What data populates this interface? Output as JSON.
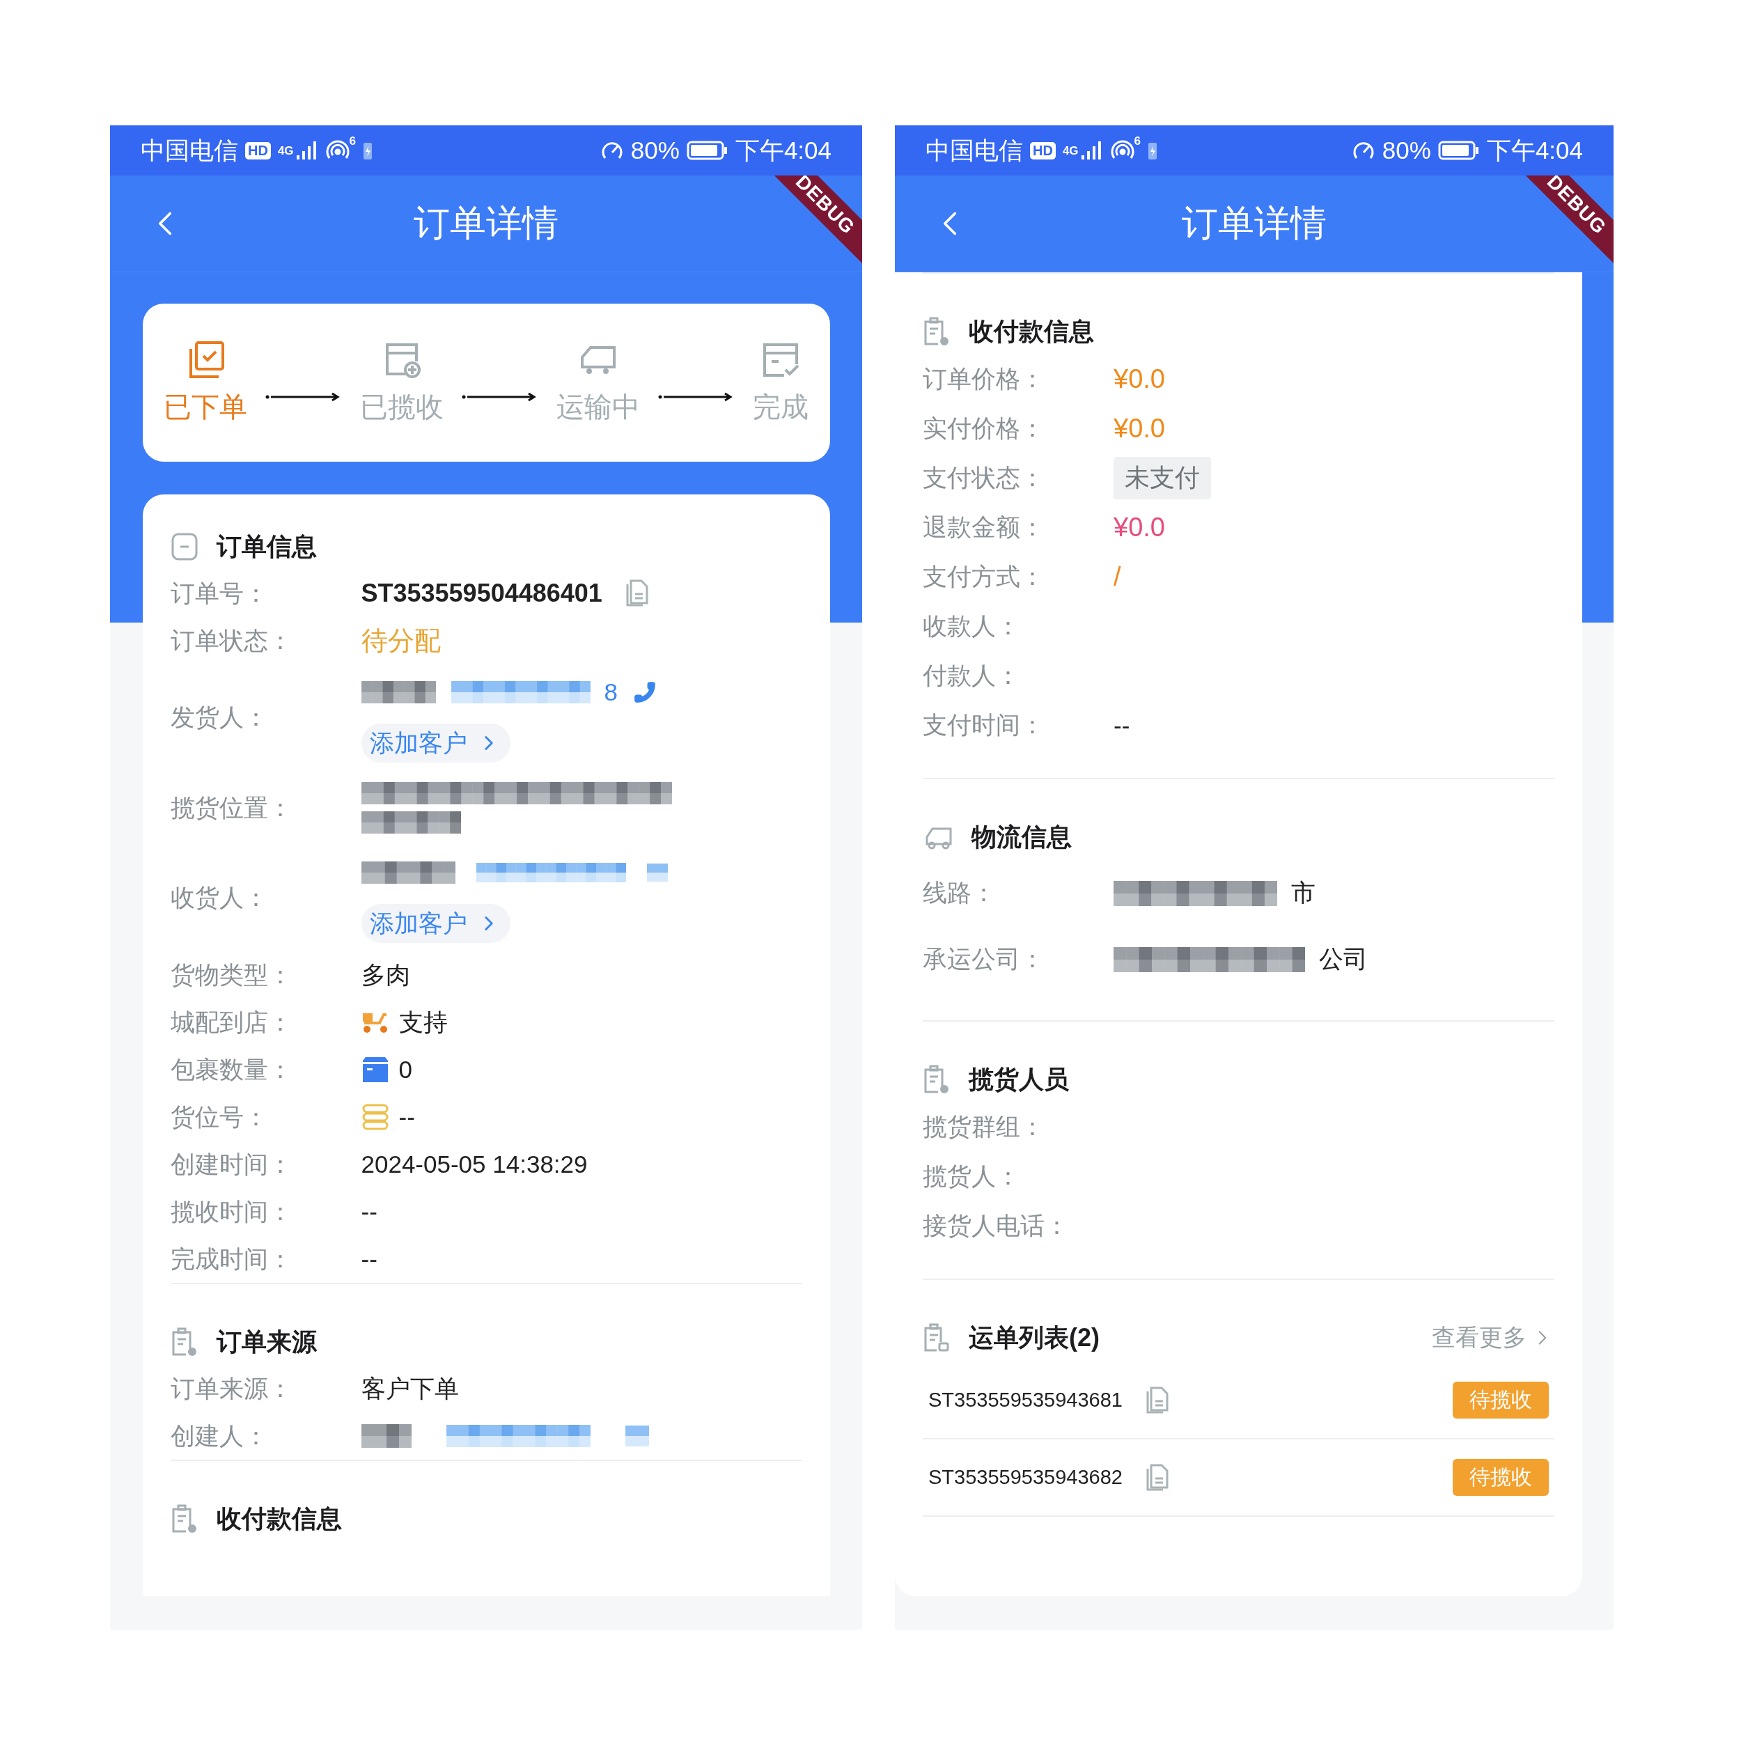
{
  "screens": [
    {
      "status_bar": {
        "carrier": "中国电信",
        "hd_badge": "HD",
        "network": "4G",
        "wifi_band": "6",
        "battery": "80%",
        "time": "下午4:04"
      },
      "debug_banner": "DEBUG",
      "nav": {
        "title": "订单详情"
      },
      "progress": [
        {
          "label": "已下单",
          "kind": "placed",
          "active": true
        },
        {
          "label": "已揽收",
          "kind": "collected",
          "active": false
        },
        {
          "label": "运输中",
          "kind": "transit",
          "active": false
        },
        {
          "label": "完成",
          "kind": "done",
          "active": false
        }
      ],
      "sections": [
        {
          "title": "订单信息",
          "kind": "order_info",
          "rows": [
            {
              "kind": "order_no",
              "label": "订单号：",
              "value": "ST353559504486401"
            },
            {
              "kind": "status",
              "label": "订单状态：",
              "value": "待分配"
            },
            {
              "kind": "sender",
              "label": "发货人：",
              "phone_tail": "8",
              "button": "添加客户"
            },
            {
              "kind": "address",
              "label": "揽货位置："
            },
            {
              "kind": "receiver",
              "label": "收货人：",
              "button": "添加客户"
            },
            {
              "kind": "text",
              "label": "货物类型：",
              "value": "多肉"
            },
            {
              "kind": "delivery",
              "label": "城配到店：",
              "value": "支持"
            },
            {
              "kind": "parcels",
              "label": "包裹数量：",
              "value": "0"
            },
            {
              "kind": "slot",
              "label": "货位号：",
              "value": "--"
            },
            {
              "kind": "text",
              "label": "创建时间：",
              "value": "2024-05-05 14:38:29"
            },
            {
              "kind": "text",
              "label": "揽收时间：",
              "value": "--"
            },
            {
              "kind": "text",
              "label": "完成时间：",
              "value": "--"
            }
          ]
        },
        {
          "title": "订单来源",
          "kind": "source",
          "rows": [
            {
              "kind": "text",
              "label": "订单来源：",
              "value": "客户下单"
            },
            {
              "kind": "person",
              "label": "创建人："
            }
          ]
        },
        {
          "title": "收付款信息",
          "kind": "payment"
        }
      ]
    },
    {
      "status_bar": {
        "carrier": "中国电信",
        "hd_badge": "HD",
        "network": "4G",
        "wifi_band": "6",
        "battery": "80%",
        "time": "下午4:04"
      },
      "debug_banner": "DEBUG",
      "nav": {
        "title": "订单详情"
      },
      "sections": [
        {
          "title": "收付款信息",
          "kind": "payment",
          "rows": [
            {
              "kind": "price",
              "label": "订单价格：",
              "value": "¥0.0"
            },
            {
              "kind": "price",
              "label": "实付价格：",
              "value": "¥0.0"
            },
            {
              "kind": "tag",
              "label": "支付状态：",
              "value": "未支付"
            },
            {
              "kind": "refund",
              "label": "退款金额：",
              "value": "¥0.0"
            },
            {
              "kind": "method",
              "label": "支付方式：",
              "value": "/"
            },
            {
              "kind": "text",
              "label": "收款人："
            },
            {
              "kind": "text",
              "label": "付款人："
            },
            {
              "kind": "text",
              "label": "支付时间：",
              "value": "--"
            }
          ]
        },
        {
          "title": "物流信息",
          "kind": "logistics",
          "rows": [
            {
              "kind": "redacted_tail",
              "label": "线路：",
              "value": "市"
            },
            {
              "kind": "redacted_tail",
              "label": "承运公司：",
              "value": "公司"
            }
          ]
        },
        {
          "title": "揽货人员",
          "kind": "staff",
          "rows": [
            {
              "kind": "text",
              "label": "揽货群组："
            },
            {
              "kind": "text",
              "label": "揽货人："
            },
            {
              "kind": "text",
              "label": "接货人电话："
            }
          ]
        },
        {
          "title": "运单列表(2)",
          "kind": "waybills",
          "more": "查看更多",
          "items": [
            {
              "number": "ST353559535943681",
              "status": "待揽收"
            },
            {
              "number": "ST353559535943682",
              "status": "待揽收"
            }
          ]
        }
      ]
    }
  ]
}
